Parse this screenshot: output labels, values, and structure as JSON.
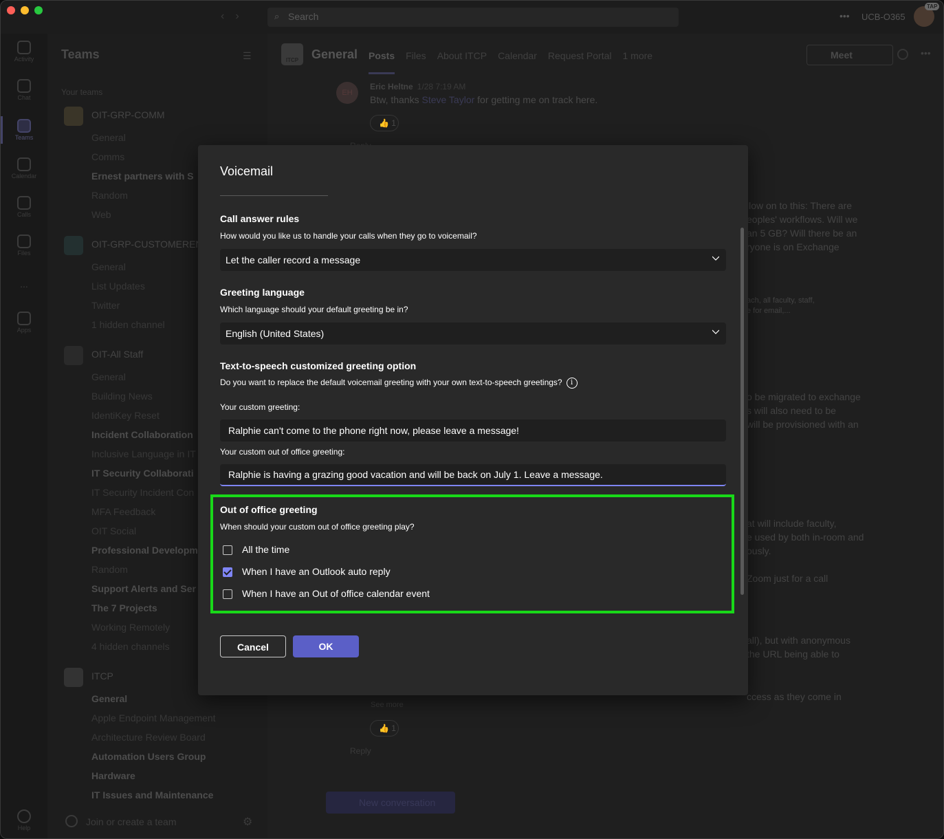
{
  "topbar": {
    "search_placeholder": "Search",
    "org": "UCB-O365",
    "avatar_badge": "TAP"
  },
  "rail": {
    "items": [
      {
        "label": "Activity",
        "icon": "bell-icon"
      },
      {
        "label": "Chat",
        "icon": "chat-icon"
      },
      {
        "label": "Teams",
        "icon": "teams-icon"
      },
      {
        "label": "Calendar",
        "icon": "calendar-icon"
      },
      {
        "label": "Calls",
        "icon": "phone-icon"
      },
      {
        "label": "Files",
        "icon": "file-icon"
      },
      {
        "label": "...",
        "icon": "more-icon"
      },
      {
        "label": "Apps",
        "icon": "apps-icon"
      },
      {
        "label": "Help",
        "icon": "help-icon"
      }
    ]
  },
  "teams_pane": {
    "title": "Teams",
    "your_teams": "Your teams",
    "teams": [
      {
        "name": "OIT-GRP-COMM",
        "channels": [
          "General",
          "Comms",
          "Ernest partners with S",
          "Random",
          "Web"
        ]
      },
      {
        "name": "OIT-GRP-CUSTOMEREN",
        "channels": [
          "General",
          "List Updates",
          "Twitter",
          "1 hidden channel"
        ]
      },
      {
        "name": "OIT-All Staff",
        "channels": [
          "General",
          "Building News",
          "IdentiKey Reset",
          "Incident Collaboration",
          "Inclusive Language in IT",
          "IT Security Collaborati",
          "IT Security Incident Con",
          "MFA Feedback",
          "OIT Social",
          "Professional Developm",
          "Random",
          "Support Alerts and Ser",
          "The 7 Projects",
          "Working Remotely",
          "4 hidden channels"
        ]
      },
      {
        "name": "ITCP",
        "channels": [
          "General",
          "Apple Endpoint Management",
          "Architecture Review Board",
          "Automation Users Group",
          "Hardware",
          "IT Issues and Maintenance"
        ]
      }
    ],
    "join": "Join or create a team"
  },
  "channel_header": {
    "logo": "ITCP",
    "title": "General",
    "tabs": [
      "Posts",
      "Files",
      "About ITCP",
      "Calendar",
      "Request Portal",
      "1 more"
    ],
    "meet": "Meet"
  },
  "feed": {
    "author_initials": "EH",
    "author": "Eric Heltne",
    "time": "1/28 7:19 AM",
    "text_before": "Btw, thanks",
    "mention": "Steve Taylor",
    "text_after": "for getting me on track here.",
    "reaction": "1",
    "reply": "Reply",
    "bg_lines": [
      "llow on to this: There are",
      "eoples' workflows. Will we",
      "an 5 GB? Will there be an",
      "ryone is on Exchange",
      "ach, all faculty, staff,",
      "e for email,...",
      "o be migrated to exchange",
      "s will also need to be",
      " will be provisioned with an",
      "at will include faculty,",
      "e used by both in-room and",
      "ously.",
      "Zoom just for a call",
      "all), but with anonymous",
      "the URL being able to",
      "ccess as they come in",
      "See more"
    ],
    "reaction2": "1",
    "reply2": "Reply",
    "new_conversation": "New conversation"
  },
  "dialog": {
    "title": "Voicemail",
    "call_rules": {
      "heading": "Call answer rules",
      "desc": "How would you like us to handle your calls when they go to voicemail?",
      "value": "Let the caller record a message"
    },
    "greeting_language": {
      "heading": "Greeting language",
      "desc": "Which language should your default greeting be in?",
      "value": "English (United States)"
    },
    "tts": {
      "heading": "Text-to-speech customized greeting option",
      "desc": "Do you want to replace the default voicemail greeting with your own text-to-speech greetings?",
      "custom_label": "Your custom greeting:",
      "custom_value": "Ralphie can't come to the phone right now, please leave a message!",
      "ooo_label": "Your custom out of office greeting:",
      "ooo_value": "Ralphie is having a grazing good vacation and will be back on July 1. Leave a message."
    },
    "ooo": {
      "heading": "Out of office greeting",
      "desc": "When should your custom out of office greeting play?",
      "options": [
        {
          "label": "All the time",
          "checked": false
        },
        {
          "label": "When I have an Outlook auto reply",
          "checked": true
        },
        {
          "label": "When I have an Out of office calendar event",
          "checked": false
        }
      ]
    },
    "cancel": "Cancel",
    "ok": "OK"
  },
  "colors": {
    "accent": "#5b5fc7",
    "highlight": "#19d819",
    "dialog_bg": "#292929"
  }
}
